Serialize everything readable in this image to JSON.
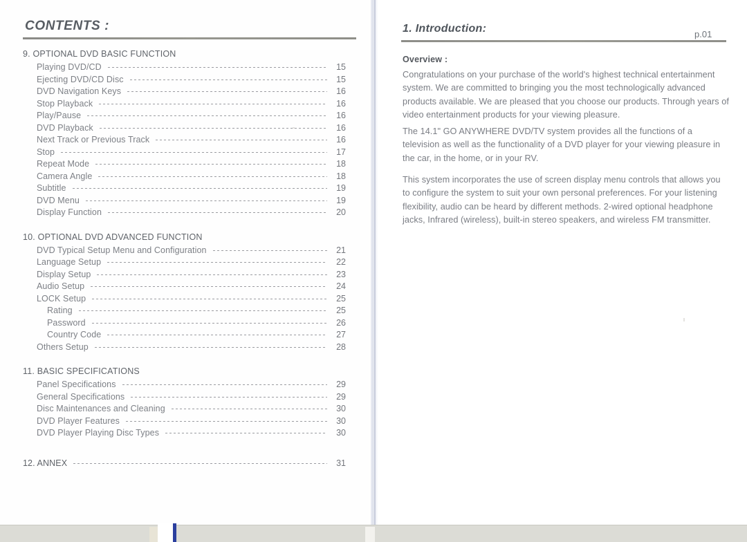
{
  "document": {
    "type": "printed-manual-spread",
    "left_page": {
      "title": "CONTENTS :",
      "toc": [
        {
          "number": "9.",
          "heading": "9. OPTIONAL DVD BASIC FUNCTION",
          "entries": [
            {
              "label": "Playing DVD/CD",
              "page": "15",
              "indent": 1
            },
            {
              "label": "Ejecting DVD/CD Disc",
              "page": "15",
              "indent": 1
            },
            {
              "label": "DVD Navigation Keys",
              "page": "16",
              "indent": 1
            },
            {
              "label": "Stop Playback",
              "page": "16",
              "indent": 1
            },
            {
              "label": "Play/Pause",
              "page": "16",
              "indent": 1
            },
            {
              "label": "DVD Playback",
              "page": "16",
              "indent": 1
            },
            {
              "label": "Next Track or Previous Track",
              "page": "16",
              "indent": 1
            },
            {
              "label": "Stop",
              "page": "17",
              "indent": 1
            },
            {
              "label": "Repeat Mode",
              "page": "18",
              "indent": 1
            },
            {
              "label": "Camera Angle",
              "page": "18",
              "indent": 1
            },
            {
              "label": "Subtitle",
              "page": "19",
              "indent": 1
            },
            {
              "label": "DVD Menu",
              "page": "19",
              "indent": 1
            },
            {
              "label": "Display Function",
              "page": "20",
              "indent": 1
            }
          ]
        },
        {
          "number": "10.",
          "heading": "10. OPTIONAL DVD ADVANCED FUNCTION",
          "entries": [
            {
              "label": "DVD Typical Setup Menu and Configuration",
              "page": "21",
              "indent": 1
            },
            {
              "label": "Language Setup",
              "page": "22",
              "indent": 1
            },
            {
              "label": "Display Setup",
              "page": "23",
              "indent": 1
            },
            {
              "label": "Audio Setup",
              "page": "24",
              "indent": 1
            },
            {
              "label": "LOCK Setup",
              "page": "25",
              "indent": 1
            },
            {
              "label": "Rating",
              "page": "25",
              "indent": 2
            },
            {
              "label": "Password",
              "page": "26",
              "indent": 2
            },
            {
              "label": "Country Code",
              "page": "27",
              "indent": 2
            },
            {
              "label": "Others Setup",
              "page": "28",
              "indent": 1
            }
          ]
        },
        {
          "number": "11.",
          "heading": "11. BASIC SPECIFICATIONS",
          "entries": [
            {
              "label": "Panel Specifications",
              "page": "29",
              "indent": 1
            },
            {
              "label": "General Specifications",
              "page": "29",
              "indent": 1
            },
            {
              "label": "Disc Maintenances and Cleaning",
              "page": "30",
              "indent": 1
            },
            {
              "label": "DVD Player Features",
              "page": "30",
              "indent": 1
            },
            {
              "label": "DVD Player Playing Disc Types",
              "page": "30",
              "indent": 1
            }
          ]
        },
        {
          "number": "12.",
          "heading": "",
          "entries": [
            {
              "label": "12. ANNEX",
              "page": "31",
              "indent": 0
            }
          ]
        }
      ]
    },
    "right_page": {
      "title": "1. Introduction:",
      "page_label": "p.01",
      "overview_heading": "Overview :",
      "paragraphs": [
        "Congratulations on your purchase of the world's highest technical entertainment system. We are committed to bringing you the most technologically advanced products available. We are pleased that you choose our products. Through years of video entertainment products for your viewing pleasure.",
        "The 14.1\" GO ANYWHERE DVD/TV system provides all the functions of a television as well as the functionality of a DVD player for your viewing pleasure in the car, in the home, or in your RV.",
        "This system incorporates the use of screen display menu controls that allows you to configure the system to suit your own personal preferences. For your listening flexibility, audio can be heard by different methods. 2-wired optional headphone jacks, Infrared (wireless), built-in stereo speakers, and wireless FM transmitter."
      ]
    },
    "colors": {
      "paper": "#fefefe",
      "body_text": "#7a7d84",
      "heading_text": "#54585e",
      "rule": "#8e8e88",
      "bottom_band": "#dcdcd6",
      "blue_stripe": "#2b3f9e"
    }
  }
}
